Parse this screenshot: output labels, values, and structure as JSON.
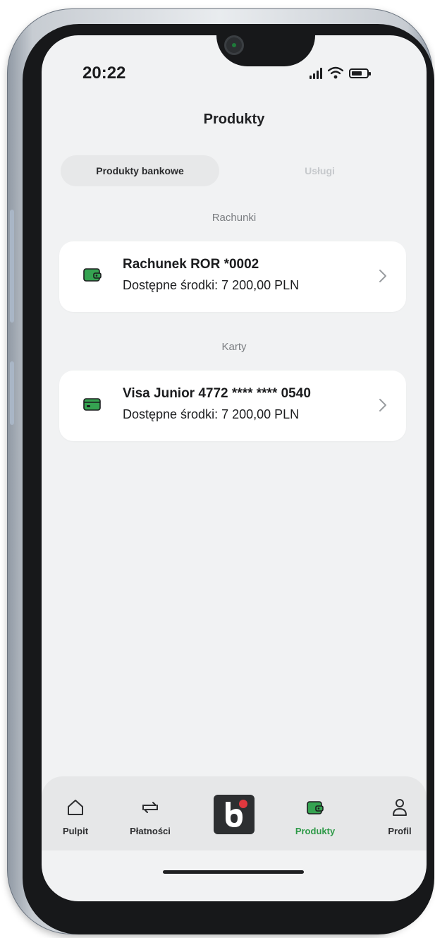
{
  "status_bar": {
    "time": "20:22"
  },
  "header": {
    "title": "Produkty"
  },
  "tabs": [
    {
      "label": "Produkty bankowe",
      "active": true
    },
    {
      "label": "Usługi",
      "active": false
    }
  ],
  "sections": {
    "accounts": {
      "label": "Rachunki",
      "item": {
        "name": "Rachunek ROR *0002",
        "balance": "Dostępne środki: 7 200,00 PLN",
        "icon": "wallet-icon"
      }
    },
    "cards": {
      "label": "Karty",
      "item": {
        "name": "Visa Junior 4772 **** **** 0540",
        "balance": "Dostępne środki: 7 200,00 PLN",
        "icon": "card-icon"
      }
    }
  },
  "bottom_nav": [
    {
      "label": "Pulpit",
      "icon": "home-icon"
    },
    {
      "label": "Płatności",
      "icon": "transfer-icon"
    },
    {
      "label": "",
      "icon": "bank-logo-icon"
    },
    {
      "label": "Produkty",
      "icon": "wallet-icon",
      "active": true
    },
    {
      "label": "Profil",
      "icon": "user-icon"
    }
  ],
  "colors": {
    "accent": "#2e9a48",
    "background": "#f1f2f3",
    "card": "#ffffff",
    "tab_active": "#e7e8e9"
  }
}
